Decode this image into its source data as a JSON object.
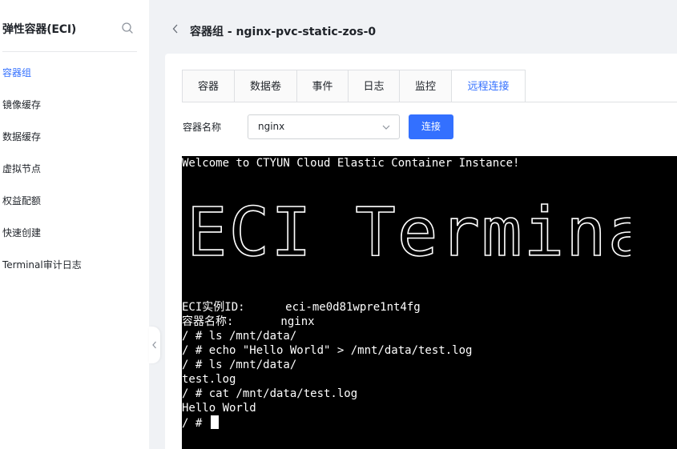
{
  "sidebar": {
    "title": "弹性容器(ECI)",
    "items": [
      {
        "label": "容器组",
        "active": true
      },
      {
        "label": "镜像缓存"
      },
      {
        "label": "数据缓存"
      },
      {
        "label": "虚拟节点"
      },
      {
        "label": "权益配额"
      },
      {
        "label": "快速创建"
      },
      {
        "label": "Terminal审计日志"
      }
    ]
  },
  "header": {
    "title": "容器组 - nginx-pvc-static-zos-0"
  },
  "tabs": [
    {
      "label": "容器"
    },
    {
      "label": "数据卷"
    },
    {
      "label": "事件"
    },
    {
      "label": "日志"
    },
    {
      "label": "监控"
    },
    {
      "label": "远程连接",
      "active": true
    }
  ],
  "form": {
    "container_label": "容器名称",
    "container_value": "nginx",
    "connect_button": "连接"
  },
  "terminal": {
    "welcome": "Welcome to CTYUN Cloud Elastic Container Instance!",
    "banner_text": "ECI Terminal",
    "lines": [
      "ECI实例ID:      eci-me0d81wpre1nt4fg",
      "容器名称:       nginx",
      "/ # ls /mnt/data/",
      "/ # echo \"Hello World\" > /mnt/data/test.log",
      "/ # ls /mnt/data/",
      "test.log",
      "/ # cat /mnt/data/test.log",
      "Hello World"
    ],
    "prompt": "/ # "
  },
  "colors": {
    "accent": "#3370ff",
    "terminal_bg": "#000000",
    "terminal_fg": "#ffffff"
  }
}
